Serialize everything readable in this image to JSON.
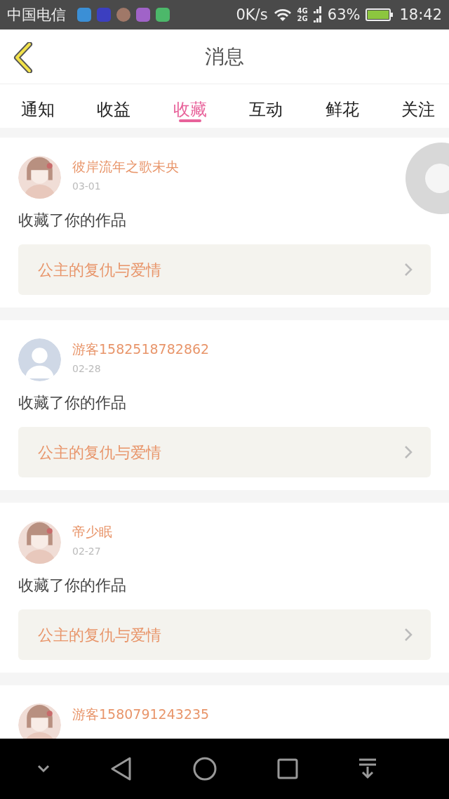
{
  "status_bar": {
    "carrier": "中国电信",
    "notification_icons": [
      {
        "color": "#3b8fd6"
      },
      {
        "color": "#3c3fc0"
      },
      {
        "color": "#a07868"
      },
      {
        "color": "#a063c8"
      },
      {
        "color": "#4cb86a"
      }
    ],
    "speed": "0K/s",
    "net_top": "4G",
    "net_bottom": "2G",
    "battery": "63%",
    "time": "18:42"
  },
  "header": {
    "title": "消息"
  },
  "tabs": [
    {
      "label": "通知",
      "selected": false
    },
    {
      "label": "收益",
      "selected": false
    },
    {
      "label": "收藏",
      "selected": true
    },
    {
      "label": "互动",
      "selected": false
    },
    {
      "label": "鲜花",
      "selected": false
    },
    {
      "label": "关注",
      "selected": false
    }
  ],
  "messages": [
    {
      "name": "彼岸流年之歌未央",
      "date": "03-01",
      "action": "收藏了你的作品",
      "work": "公主的复仇与爱情"
    },
    {
      "avatar": {
        "kind": "default"
      },
      "name": "游客1582518782862",
      "date": "02-28",
      "action": "收藏了你的作品",
      "work": "公主的复仇与爱情"
    },
    {
      "name": "帝少眠",
      "date": "02-27",
      "action": "收藏了你的作品",
      "work": "公主的复仇与爱情"
    },
    {
      "name": "游客1580791243235"
    }
  ]
}
